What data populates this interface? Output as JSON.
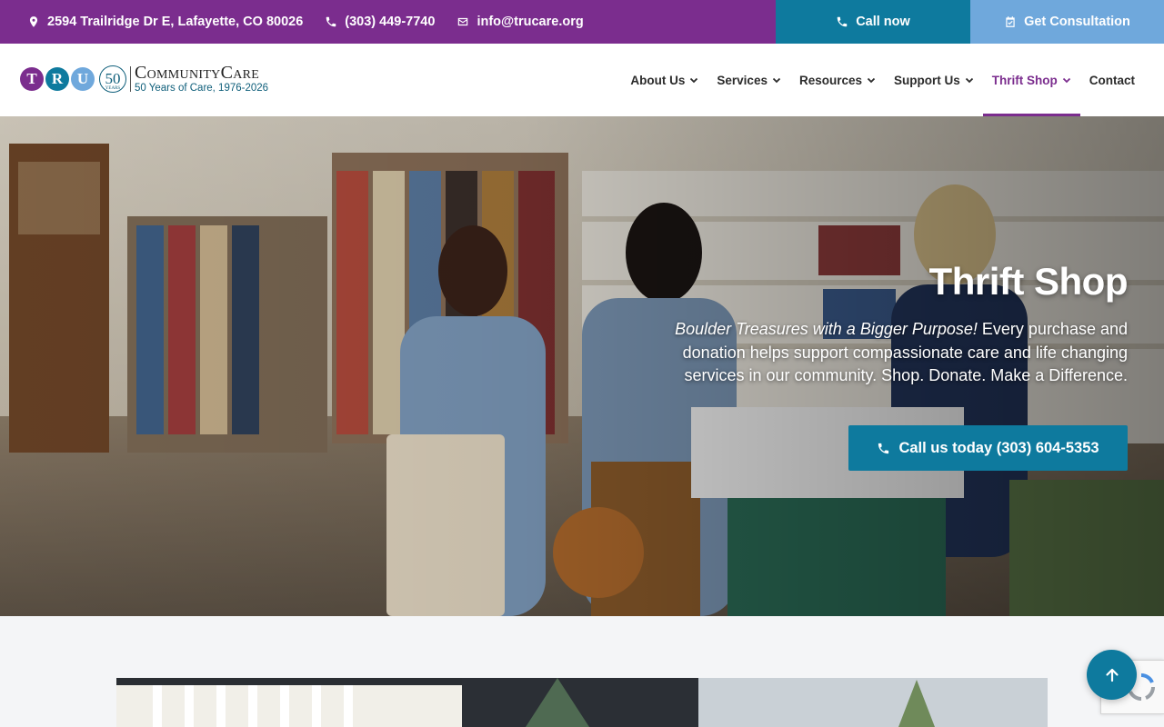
{
  "topbar": {
    "address": "2594 Trailridge Dr E, Lafayette, CO 80026",
    "phone": "(303) 449-7740",
    "email": "info@trucare.org",
    "call_now": "Call now",
    "consultation": "Get Consultation",
    "icons": {
      "address": "map-pin-icon",
      "phone": "phone-icon",
      "email": "envelope-icon",
      "call_now": "phone-icon",
      "consultation": "calendar-check-icon"
    }
  },
  "logo": {
    "letters": [
      "T",
      "R",
      "U"
    ],
    "anniversary": "50",
    "anniversary_sub": "YEARS",
    "name": "CommunityCare",
    "tagline": "50 Years of Care, 1976-2026"
  },
  "nav": {
    "items": [
      {
        "label": "About Us",
        "has_dropdown": true
      },
      {
        "label": "Services",
        "has_dropdown": true
      },
      {
        "label": "Resources",
        "has_dropdown": true
      },
      {
        "label": "Support Us",
        "has_dropdown": true
      },
      {
        "label": "Thrift Shop",
        "has_dropdown": true,
        "active": true
      },
      {
        "label": "Contact",
        "has_dropdown": false
      }
    ]
  },
  "hero": {
    "title": "Thrift Shop",
    "tagline_italic": "Boulder Treasures with a Bigger Purpose!",
    "description": " Every purchase and donation helps support compassionate care and life changing services in our community. Shop. Donate. Make a Difference.",
    "cta": "Call us today (303) 604-5353",
    "cta_icon": "phone-icon"
  },
  "colors": {
    "purple": "#7b2d8e",
    "teal": "#0e7a9e",
    "light_blue": "#6fa8dc"
  },
  "floating": {
    "scroll_top_icon": "arrow-up-icon",
    "recaptcha_icon": "recaptcha-icon"
  }
}
